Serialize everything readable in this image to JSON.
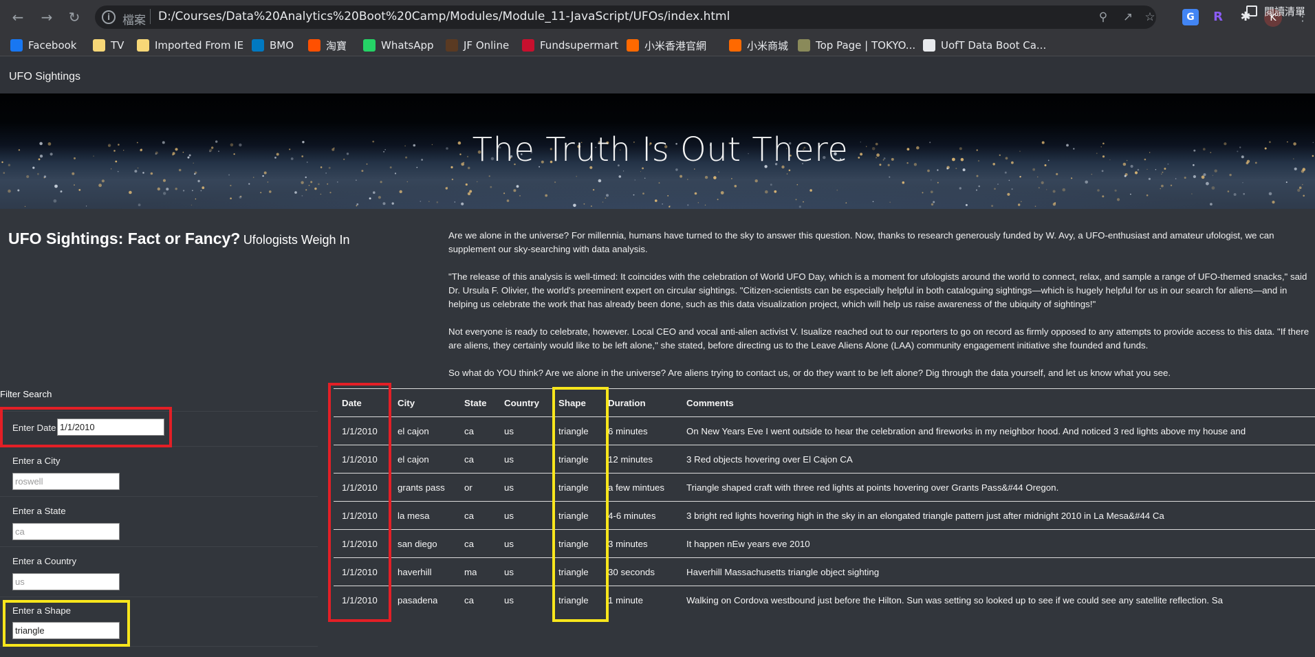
{
  "browser": {
    "file_label": "檔案",
    "url": "D:/Courses/Data%20Analytics%20Boot%20Camp/Modules/Module_11-JavaScript/UFOs/index.html",
    "avatar_letter": "K",
    "bookmarks": [
      {
        "label": "Facebook",
        "icon": "facebook-icon",
        "color": "#1877f2"
      },
      {
        "label": "TV",
        "icon": "folder-icon",
        "color": "#f7d777"
      },
      {
        "label": "Imported From IE",
        "icon": "folder-icon",
        "color": "#f7d777"
      },
      {
        "label": "BMO",
        "icon": "bmo-icon",
        "color": "#0079c1"
      },
      {
        "label": "淘寶",
        "icon": "taobao-icon",
        "color": "#ff5000"
      },
      {
        "label": "WhatsApp",
        "icon": "whatsapp-icon",
        "color": "#25d366"
      },
      {
        "label": "JF Online",
        "icon": "jpm-icon",
        "color": "#5a3a22"
      },
      {
        "label": "Fundsupermart",
        "icon": "fsm-icon",
        "color": "#c8102e"
      },
      {
        "label": "小米香港官網",
        "icon": "mi-icon",
        "color": "#ff6900"
      },
      {
        "label": "小米商城",
        "icon": "mi-icon",
        "color": "#ff6900"
      },
      {
        "label": "Top Page | TOKYO...",
        "icon": "tokyo-icon",
        "color": "#8a8a5a"
      },
      {
        "label": "UofT Data Boot Ca...",
        "icon": "globe-icon",
        "color": "#e8eaed"
      }
    ],
    "reading_list": "閱讀清單"
  },
  "nav": {
    "brand": "UFO Sightings"
  },
  "hero": {
    "title": "The Truth Is Out There"
  },
  "intro": {
    "title": "UFO Sightings: Fact or Fancy?",
    "subtitle": "Ufologists Weigh In",
    "paragraphs": [
      "Are we alone in the universe? For millennia, humans have turned to the sky to answer this question. Now, thanks to research generously funded by W. Avy, a UFO-enthusiast and amateur ufologist, we can supplement our sky-searching with data analysis.",
      "\"The release of this analysis is well-timed: It coincides with the celebration of World UFO Day, which is a moment for ufologists around the world to connect, relax, and sample a range of UFO-themed snacks,\" said Dr. Ursula F. Olivier, the world's preeminent expert on circular sightings. \"Citizen-scientists can be especially helpful in both cataloguing sightings—which is hugely helpful for us in our search for aliens—and in helping us celebrate the work that has already been done, such as this data visualization project, which will help us raise awareness of the ubiquity of sightings!\"",
      "Not everyone is ready to celebrate, however. Local CEO and vocal anti-alien activist V. Isualize reached out to our reporters to go on record as firmly opposed to any attempts to provide access to this data. \"If there are aliens, they certainly would like to be left alone,\" she stated, before directing us to the Leave Aliens Alone (LAA) community engagement initiative she founded and funds.",
      "So what do YOU think? Are we alone in the universe? Are aliens trying to contact us, or do they want to be left alone? Dig through the data yourself, and let us know what you see."
    ]
  },
  "filters": {
    "title": "Filter Search",
    "date": {
      "label": "Enter Date",
      "value": "1/1/2010",
      "placeholder": ""
    },
    "city": {
      "label": "Enter a City",
      "value": "",
      "placeholder": "roswell"
    },
    "state": {
      "label": "Enter a State",
      "value": "",
      "placeholder": "ca"
    },
    "country": {
      "label": "Enter a Country",
      "value": "",
      "placeholder": "us"
    },
    "shape": {
      "label": "Enter a Shape",
      "value": "triangle",
      "placeholder": ""
    }
  },
  "table": {
    "headers": [
      "Date",
      "City",
      "State",
      "Country",
      "Shape",
      "Duration",
      "Comments"
    ],
    "rows": [
      [
        "1/1/2010",
        "el cajon",
        "ca",
        "us",
        "triangle",
        "6 minutes",
        "On New Years Eve I went outside to hear the celebration and fireworks in my neighbor hood. And noticed 3 red lights above my house and"
      ],
      [
        "1/1/2010",
        "el cajon",
        "ca",
        "us",
        "triangle",
        "12 minutes",
        "3 Red objects hovering over El Cajon CA"
      ],
      [
        "1/1/2010",
        "grants pass",
        "or",
        "us",
        "triangle",
        "a few mintues",
        "Triangle shaped craft with three red lights at points hovering over Grants Pass&#44 Oregon."
      ],
      [
        "1/1/2010",
        "la mesa",
        "ca",
        "us",
        "triangle",
        "4-6 minutes",
        "3 bright red lights hovering high in the sky in an elongated triangle pattern just after midnight 2010 in La Mesa&#44 Ca"
      ],
      [
        "1/1/2010",
        "san diego",
        "ca",
        "us",
        "triangle",
        "3 minutes",
        "It happen nEw years eve 2010"
      ],
      [
        "1/1/2010",
        "haverhill",
        "ma",
        "us",
        "triangle",
        "30 seconds",
        "Haverhill Massachusetts triangle object sighting"
      ],
      [
        "1/1/2010",
        "pasadena",
        "ca",
        "us",
        "triangle",
        "1 minute",
        "Walking on Cordova westbound just before the Hilton. Sun was setting so looked up to see if we could see any satellite reflection. Sa"
      ]
    ]
  },
  "highlight_colors": {
    "red": "#e31f26",
    "yellow": "#f8e61c"
  }
}
